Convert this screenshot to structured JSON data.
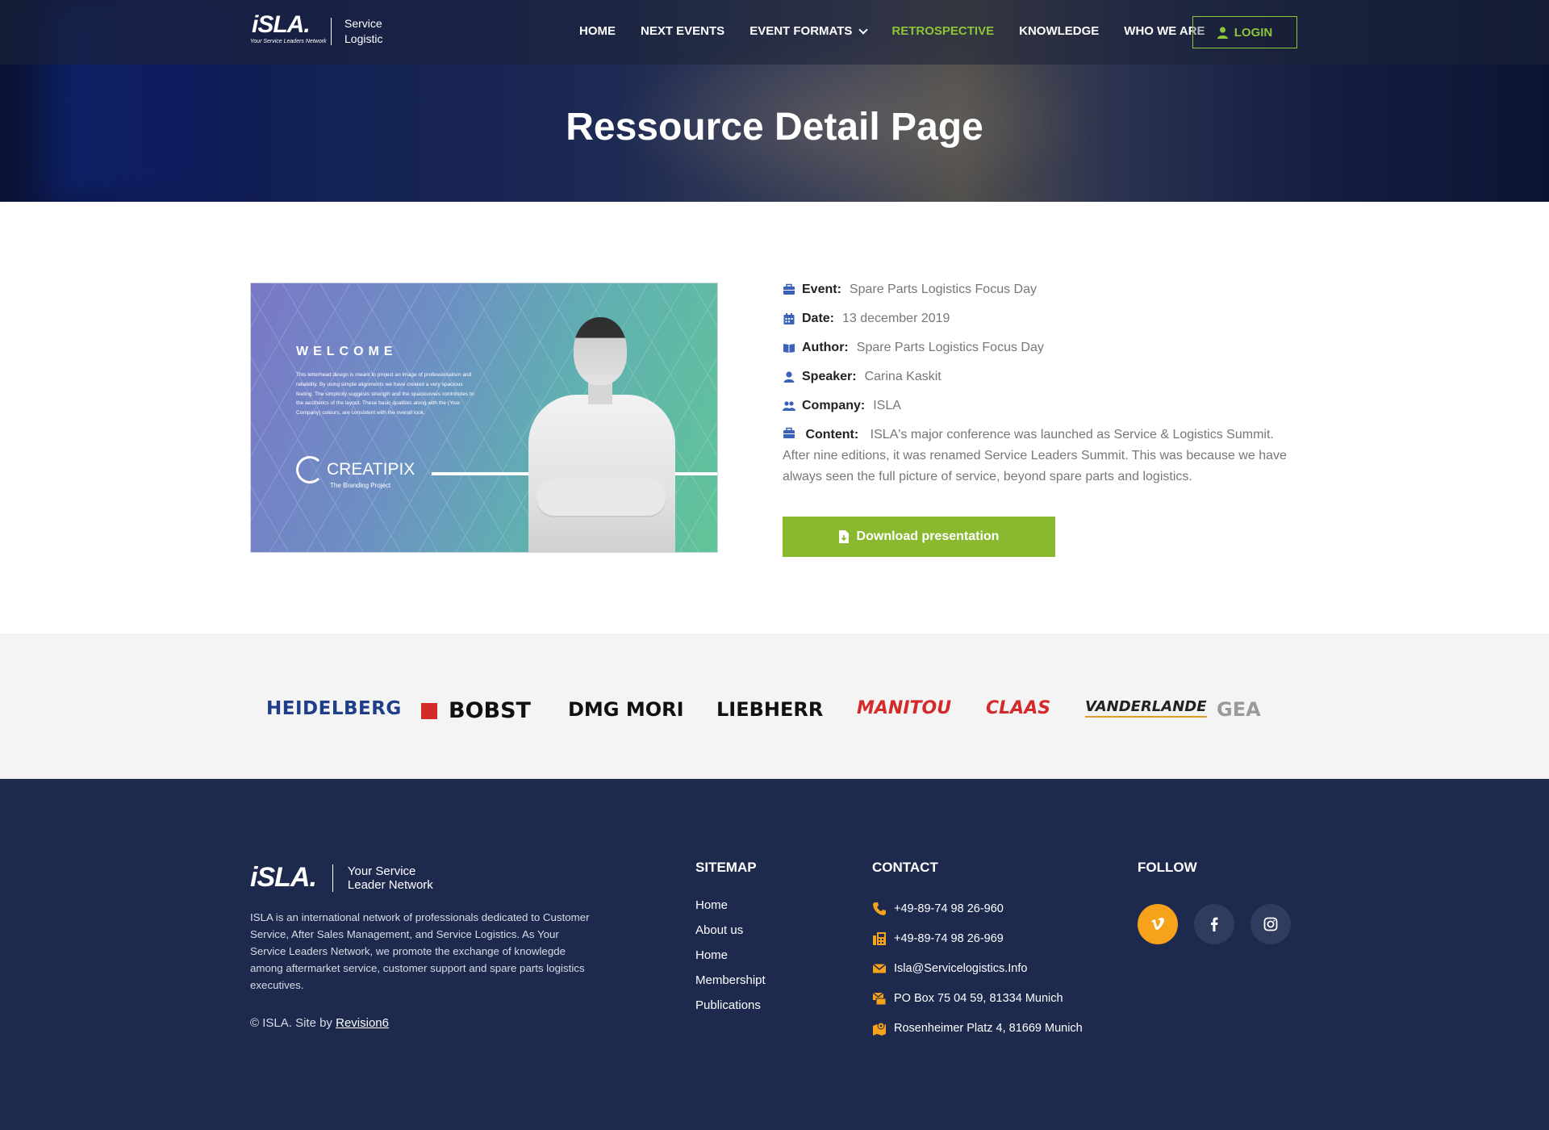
{
  "header": {
    "logo_word": "iSLA.",
    "logo_tagline": "Your Service Leaders Network",
    "logo_sub_1": "Service",
    "logo_sub_2": "Logistic",
    "nav": [
      {
        "label": "HOME"
      },
      {
        "label": "NEXT EVENTS"
      },
      {
        "label": "EVENT FORMATS"
      },
      {
        "label": "RETROSPECTIVE"
      },
      {
        "label": "KNOWLEDGE"
      },
      {
        "label": "WHO WE ARE"
      }
    ],
    "login_label": "LOGIN",
    "accent_color": "#8cc43a"
  },
  "hero": {
    "title": "Ressource Detail Page"
  },
  "thumbnail": {
    "heading": "WELCOME",
    "blurb": "This letterhead design is meant to project an image of professionalism and reliability. By using simple alignments we have created a very spacious feeling. The simplicity suggests strength and the spaciousnes contributes to the aesthetics of the layout. These basic qualities along with the (Your Company) colours, are consistent with the overall look.",
    "brand": "CREATIPIX",
    "brand_sub": "The Branding Project"
  },
  "details": {
    "event_label": "Event:",
    "event_value": "Spare Parts Logistics Focus Day",
    "date_label": "Date:",
    "date_value": "13 december 2019",
    "author_label": "Author:",
    "author_value": "Spare Parts Logistics Focus Day",
    "speaker_label": "Speaker:",
    "speaker_value": "Carina Kaskit",
    "company_label": "Company:",
    "company_value": "ISLA",
    "content_label": "Content:",
    "content_value": "ISLA's major conference was launched as Service & Logistics Summit. After nine editions, it was renamed Service Leaders Summit. This was because we have always seen the full picture of service, beyond spare parts and logistics.",
    "download_label": "Download presentation",
    "button_color": "#8ab82f"
  },
  "sponsors": [
    "HEIDELBERG",
    "BOBST",
    "DMG MORI",
    "LIEBHERR",
    "MANITOU",
    "CLAAS",
    "VANDERLANDE",
    "GEA"
  ],
  "footer": {
    "logo_word": "iSLA.",
    "logo_sub_1": "Your Service",
    "logo_sub_2": "Leader Network",
    "about": "ISLA is an international network of professionals dedicated to Customer Service, After Sales Management, and Service Logistics. As Your Service Leaders Network, we promote the exchange of knowlegde among aftermarket service, customer support and spare parts logistics executives.",
    "copyright": "© ISLA. Site by",
    "copyright_link": "Revision6",
    "sitemap_title": "SITEMAP",
    "sitemap": [
      "Home",
      "About us",
      "Home",
      "Membershipt",
      "Publications"
    ],
    "contact_title": "CONTACT",
    "contact": {
      "phone": "+49-89-74 98  26-960",
      "fax": "+49-89-74 98 26-969",
      "email": "Isla@Servicelogistics.Info",
      "po_box": "PO Box 75 04 59, 81334 Munich",
      "address": "Rosenheimer Platz 4, 81669 Munich"
    },
    "follow_title": "FOLLOW",
    "social_icons": [
      "vimeo-icon",
      "facebook-icon",
      "instagram-icon"
    ],
    "bg_color": "#1d2a4e",
    "icon_color": "#f7a21b"
  }
}
